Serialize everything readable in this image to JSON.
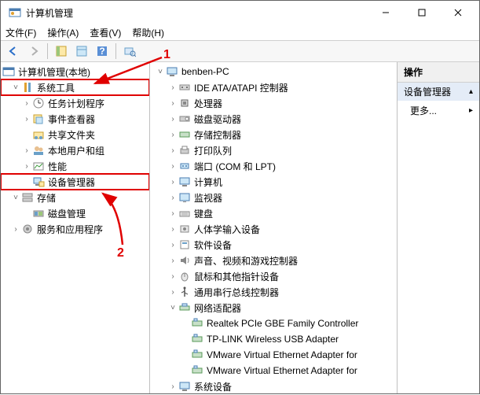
{
  "window": {
    "title": "计算机管理"
  },
  "menu": {
    "file": "文件(F)",
    "action": "操作(A)",
    "view": "查看(V)",
    "help": "帮助(H)"
  },
  "annotations": {
    "a1": "1",
    "a2": "2"
  },
  "left_tree": {
    "root": "计算机管理(本地)",
    "system_tools": "系统工具",
    "task_scheduler": "任务计划程序",
    "event_viewer": "事件查看器",
    "shared_folders": "共享文件夹",
    "local_users": "本地用户和组",
    "performance": "性能",
    "device_manager": "设备管理器",
    "storage": "存储",
    "disk_management": "磁盘管理",
    "services_apps": "服务和应用程序"
  },
  "mid_tree": {
    "root": "benben-PC",
    "ide": "IDE ATA/ATAPI 控制器",
    "cpu": "处理器",
    "cdrom": "磁盘驱动器",
    "storage_ctrl": "存储控制器",
    "print_queue": "打印队列",
    "ports": "端口 (COM 和 LPT)",
    "computer": "计算机",
    "monitor": "监视器",
    "keyboard": "键盘",
    "hid": "人体学输入设备",
    "software_dev": "软件设备",
    "sound": "声音、视频和游戏控制器",
    "mouse": "鼠标和其他指针设备",
    "usb": "通用串行总线控制器",
    "network": "网络适配器",
    "net1": "Realtek PCIe GBE Family Controller",
    "net2": "TP-LINK Wireless USB Adapter",
    "net3": "VMware Virtual Ethernet Adapter for",
    "net4": "VMware Virtual Ethernet Adapter for",
    "system_dev": "系统设备"
  },
  "right": {
    "head": "操作",
    "sub": "设备管理器",
    "more": "更多..."
  }
}
